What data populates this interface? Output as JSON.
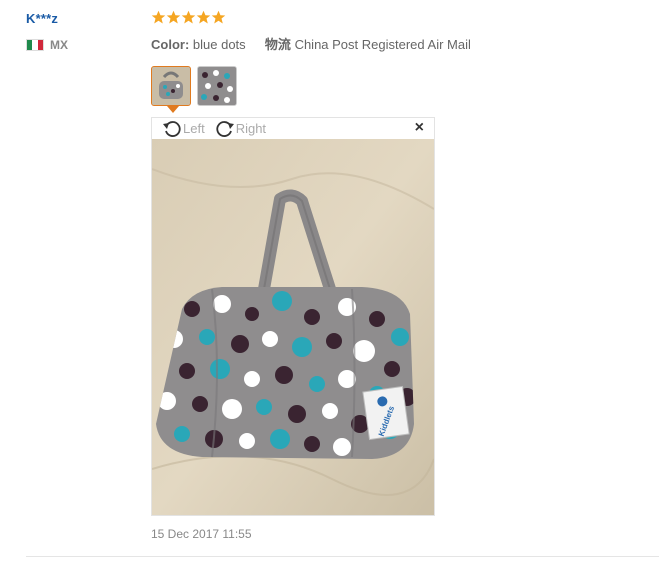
{
  "review": {
    "user": "K***z",
    "country_code": "MX",
    "rating": 5,
    "color_label": "Color:",
    "color_value": "blue dots",
    "shipping_label": "物流",
    "shipping_value": "China Post Registered Air Mail",
    "date": "15 Dec 2017 11:55"
  },
  "viewer": {
    "rotate_left_label": "Left",
    "rotate_right_label": "Right",
    "close_glyph": "×"
  },
  "photo": {
    "brand_tag": "Kiddlets"
  },
  "icons": {
    "star": "star-icon",
    "rotate_left": "rotate-left-icon",
    "rotate_right": "rotate-right-icon",
    "close": "close-icon",
    "flag": "mexico-flag-icon"
  },
  "colors": {
    "user": "#1a5ba6",
    "star": "#f5a623",
    "thumb_active": "#e07a1f",
    "dot_teal": "#2aa7b8",
    "dot_plum": "#3a2431",
    "bag_gray": "#8f8d8e"
  }
}
